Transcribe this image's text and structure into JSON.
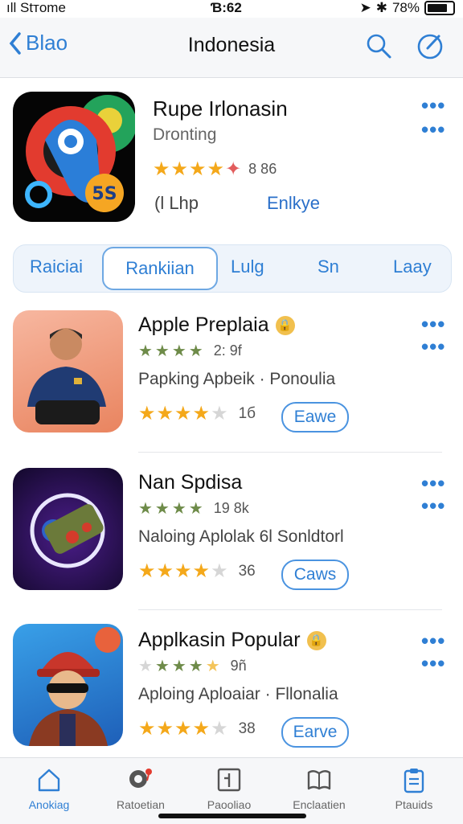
{
  "status_bar": {
    "carrier": "ıll Stтome",
    "time": "Ɓ:62",
    "battery": "78%",
    "battery_level": 0.78
  },
  "nav": {
    "back_label": "Blao",
    "title": "Indonesia"
  },
  "hero": {
    "title": "Rupe Irlonasin",
    "subtitle": "Dronting",
    "rating_value": "8 86",
    "left_label": "(l Lhp",
    "right_label": "Enlkye"
  },
  "tabs": [
    "Raiciai",
    "Rankiian",
    "Lulg",
    "Sn",
    "Laay"
  ],
  "apps": [
    {
      "title": "Apple Preplaia",
      "rating_small": "2: 9f",
      "desc": "Papking Apbeik · Ponoulia",
      "rating_value": "1б",
      "button": "Eawe"
    },
    {
      "title": "Nan Spdisa",
      "rating_small": "19 8k",
      "desc": "Naloing Aplolak 6l Sonldtorl",
      "rating_value": "36",
      "button": "Caws"
    },
    {
      "title": "Applkasin Popular",
      "rating_small": "9ñ",
      "desc": "Aploing Aploaiar · Fllonalia",
      "rating_value": "38",
      "button": "Earve"
    }
  ],
  "tabbar": [
    "Anokiag",
    "Ratoetian",
    "Paooliao",
    "Enclaatien",
    "Ptauids"
  ],
  "colors": {
    "accent": "#2f7fd4",
    "star": "#f4a81a"
  }
}
